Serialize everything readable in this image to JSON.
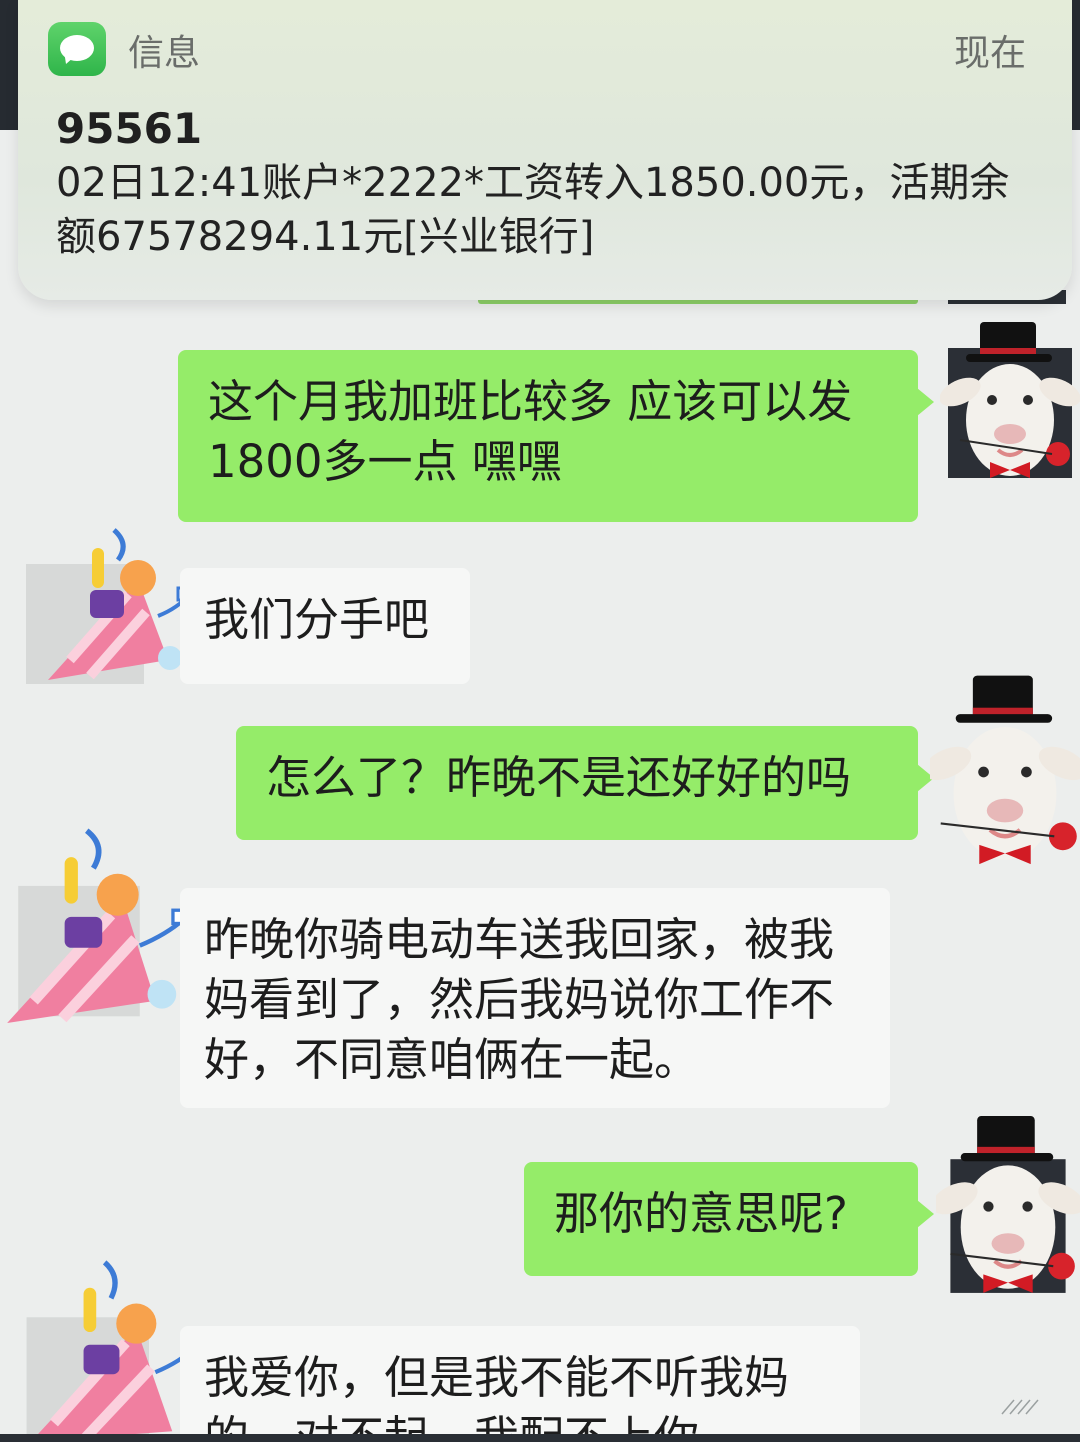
{
  "notification": {
    "app_name": "信息",
    "time": "现在",
    "sender": "95561",
    "body": "02日12:41账户*2222*工资转入1850.00元，活期余额67578294.11元[兴业银行]"
  },
  "messages": [
    {
      "side": "out",
      "text": "这个月我加班比较多 应该可以发1800多一点 嘿嘿"
    },
    {
      "side": "in",
      "text": "我们分手吧"
    },
    {
      "side": "out",
      "text": "怎么了？昨晚不是还好好的吗"
    },
    {
      "side": "in",
      "text": "昨晚你骑电动车送我回家，被我妈看到了，然后我妈说你工作不好，不同意咱俩在一起。"
    },
    {
      "side": "out",
      "text": "那你的意思呢?"
    },
    {
      "side": "in",
      "text": "我爱你，但是我不能不听我妈的，对不起，我配不上你"
    }
  ],
  "colors": {
    "outgoing_bubble": "#95ec69",
    "incoming_bubble": "#f6f7f6",
    "chat_background": "#eceeed"
  },
  "avatars": {
    "self": "sheep-with-top-hat-icon",
    "contact": "party-popper-icon"
  }
}
